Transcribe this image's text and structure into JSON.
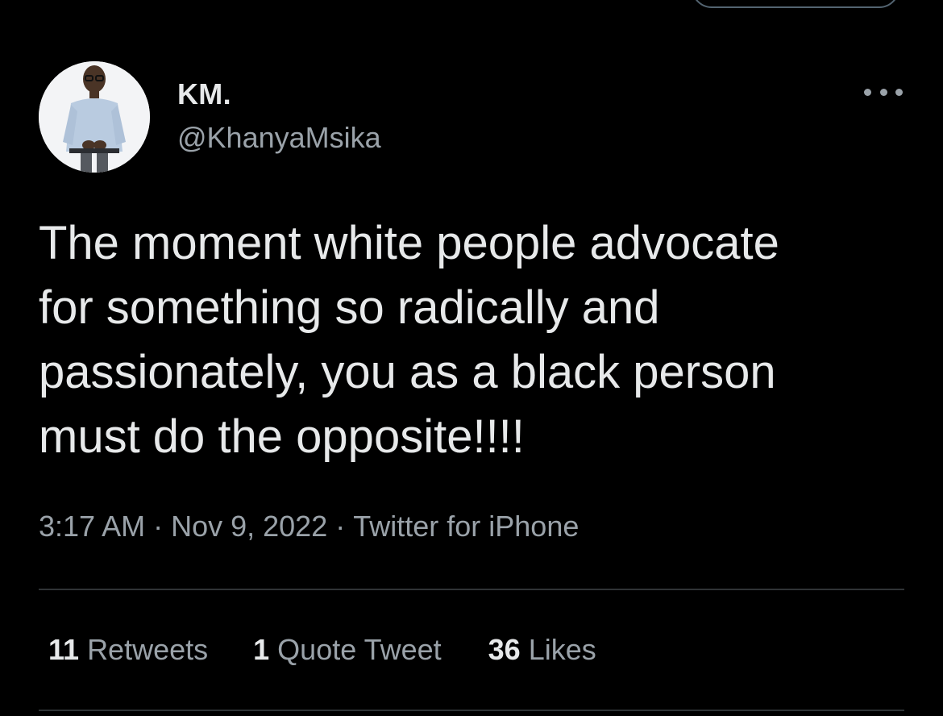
{
  "author": {
    "display_name": "KM.",
    "handle": "@KhanyaMsika",
    "avatar_icon": "profile-photo"
  },
  "tweet": {
    "text": "The moment white people advocate\nfor something so radically and\npassionately, you as a black person\nmust do the opposite!!!!"
  },
  "meta": {
    "time": "3:17 AM",
    "date": "Nov 9, 2022",
    "source": "Twitter for iPhone",
    "separator": "·"
  },
  "stats": {
    "retweets_count": "11",
    "retweets_label": "Retweets",
    "quotes_count": "1",
    "quotes_label": "Quote Tweet",
    "likes_count": "36",
    "likes_label": "Likes"
  },
  "colors": {
    "background": "#000000",
    "primary_text": "#e7e9ea",
    "secondary_text": "#9aa2a9",
    "divider": "#2f3336"
  }
}
